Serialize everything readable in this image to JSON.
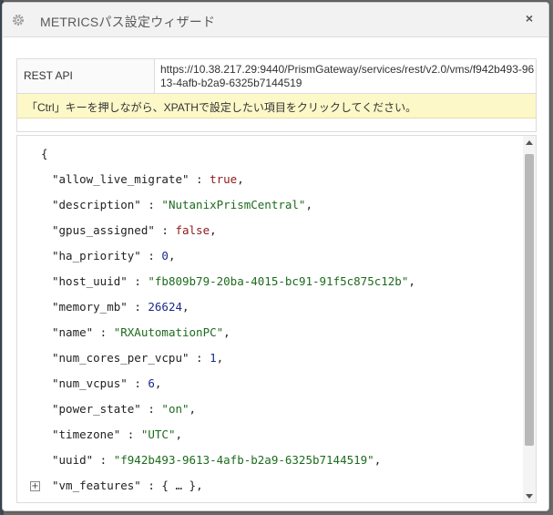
{
  "window": {
    "title": "METRICSパス設定ウィザード",
    "close_symbol": "×",
    "gear_icon": "gear-icon",
    "close_icon": "close-icon"
  },
  "info": {
    "api_label": "REST API",
    "api_url": "https://10.38.217.29:9440/PrismGateway/services/rest/v2.0/vms/f942b493-9613-4afb-b2a9-6325b7144519",
    "hint": "「Ctrl」キーを押しながら、XPATHで設定したい項目をクリックしてください。"
  },
  "json_view": {
    "open_brace": "{",
    "lines": [
      {
        "key": "\"allow_live_migrate\"",
        "sep": " : ",
        "value": "true",
        "type": "b",
        "tail": ","
      },
      {
        "key": "\"description\"",
        "sep": " : ",
        "value": "\"NutanixPrismCentral\"",
        "type": "s",
        "tail": ","
      },
      {
        "key": "\"gpus_assigned\"",
        "sep": " : ",
        "value": "false",
        "type": "b",
        "tail": ","
      },
      {
        "key": "\"ha_priority\"",
        "sep": " : ",
        "value": "0",
        "type": "n",
        "tail": ","
      },
      {
        "key": "\"host_uuid\"",
        "sep": " : ",
        "value": "\"fb809b79-20ba-4015-bc91-91f5c875c12b\"",
        "type": "s",
        "tail": ","
      },
      {
        "key": "\"memory_mb\"",
        "sep": " : ",
        "value": "26624",
        "type": "n",
        "tail": ","
      },
      {
        "key": "\"name\"",
        "sep": " : ",
        "value": "\"RXAutomationPC\"",
        "type": "s",
        "tail": ","
      },
      {
        "key": "\"num_cores_per_vcpu\"",
        "sep": " : ",
        "value": "1",
        "type": "n",
        "tail": ","
      },
      {
        "key": "\"num_vcpus\"",
        "sep": " : ",
        "value": "6",
        "type": "n",
        "tail": ","
      },
      {
        "key": "\"power_state\"",
        "sep": " : ",
        "value": "\"on\"",
        "type": "s",
        "tail": ","
      },
      {
        "key": "\"timezone\"",
        "sep": " : ",
        "value": "\"UTC\"",
        "type": "s",
        "tail": ","
      },
      {
        "key": "\"uuid\"",
        "sep": " : ",
        "value": "\"f942b493-9613-4afb-b2a9-6325b7144519\"",
        "type": "s",
        "tail": ","
      },
      {
        "key": "\"vm_features\"",
        "sep": " : ",
        "value": "{ … }",
        "type": "k",
        "tail": ",",
        "collapsible": true,
        "expand_symbol": "+"
      }
    ]
  },
  "colors": {
    "hint_background": "#fdf8c8",
    "boolean": "#8b1a1a",
    "string": "#1d6b1d",
    "number": "#1a2a8b"
  }
}
